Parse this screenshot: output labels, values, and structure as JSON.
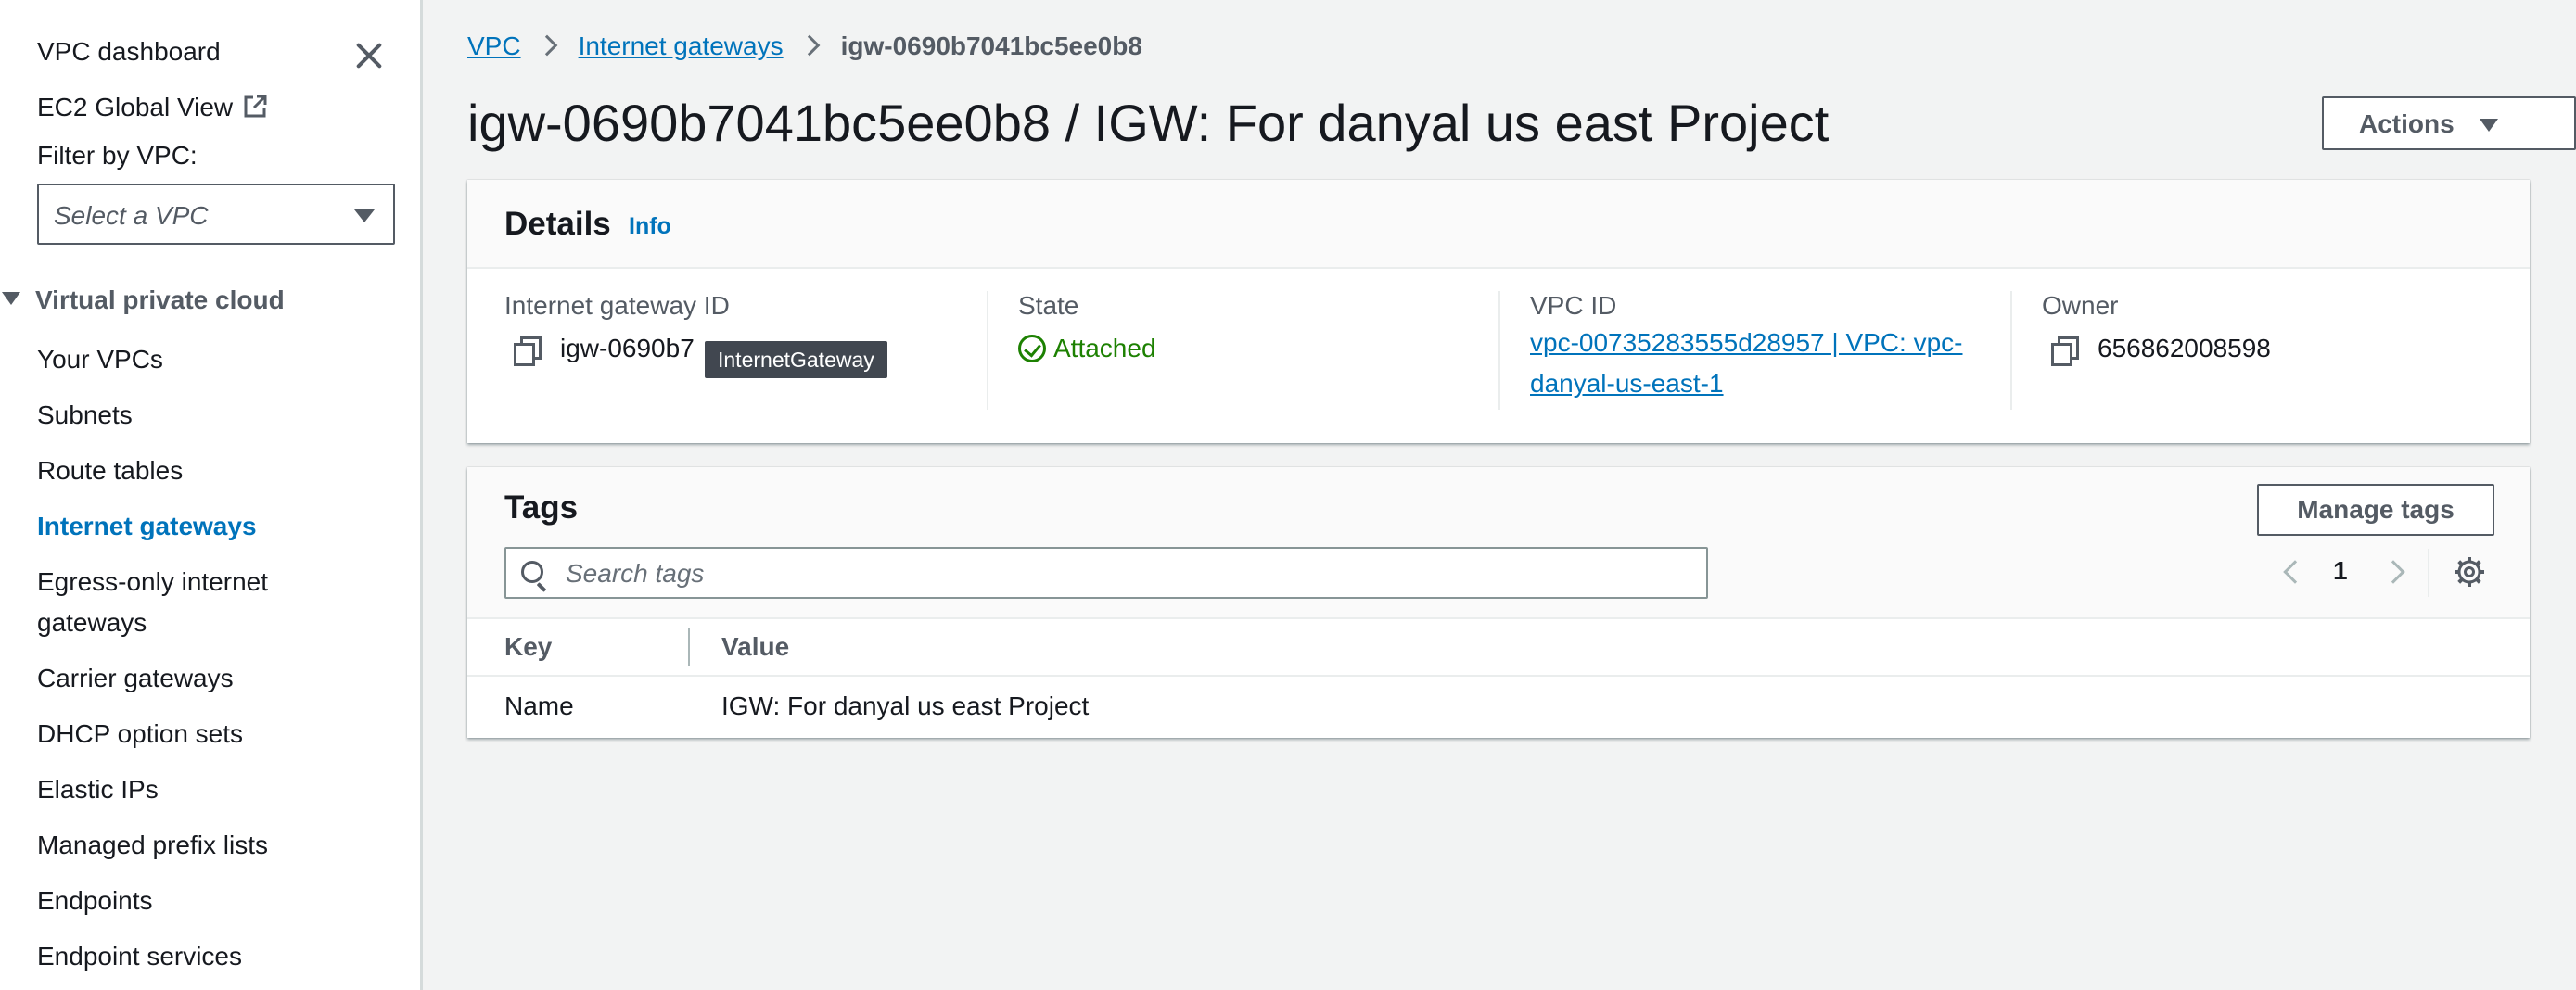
{
  "sidebar": {
    "dashboard": "VPC dashboard",
    "ec2_global_view": "EC2 Global View",
    "filter_label": "Filter by VPC:",
    "filter_placeholder": "Select a VPC",
    "section_title": "Virtual private cloud",
    "items": [
      {
        "label": "Your VPCs",
        "active": false
      },
      {
        "label": "Subnets",
        "active": false
      },
      {
        "label": "Route tables",
        "active": false
      },
      {
        "label": "Internet gateways",
        "active": true
      },
      {
        "label": "Egress-only internet",
        "active": false
      },
      {
        "label": "gateways",
        "active": false
      },
      {
        "label": "Carrier gateways",
        "active": false
      },
      {
        "label": "DHCP option sets",
        "active": false
      },
      {
        "label": "Elastic IPs",
        "active": false
      },
      {
        "label": "Managed prefix lists",
        "active": false
      },
      {
        "label": "Endpoints",
        "active": false
      },
      {
        "label": "Endpoint services",
        "active": false
      }
    ]
  },
  "breadcrumb": {
    "vpc": "VPC",
    "internet_gateways": "Internet gateways",
    "current": "igw-0690b7041bc5ee0b8"
  },
  "page_title": "igw-0690b7041bc5ee0b8 / IGW: For danyal us east Project",
  "actions_label": "Actions",
  "details": {
    "title": "Details",
    "info": "Info",
    "gateway_id_label": "Internet gateway ID",
    "gateway_id_value": "igw-0690b7",
    "tooltip": "InternetGateway",
    "state_label": "State",
    "state_value": "Attached",
    "vpc_id_label": "VPC ID",
    "vpc_id_line1": "vpc-00735283555d28957 | VPC: vpc-",
    "vpc_id_line2": "danyal-us-east-1",
    "owner_label": "Owner",
    "owner_value": "656862008598"
  },
  "tags": {
    "title": "Tags",
    "manage_label": "Manage tags",
    "search_placeholder": "Search tags",
    "page": "1",
    "columns": [
      "Key",
      "Value"
    ],
    "rows": [
      {
        "key": "Name",
        "value": "IGW: For danyal us east Project"
      }
    ]
  },
  "colors": {
    "link": "#0073bb",
    "success": "#1d8102",
    "text": "#16191f",
    "muted": "#545b64"
  }
}
